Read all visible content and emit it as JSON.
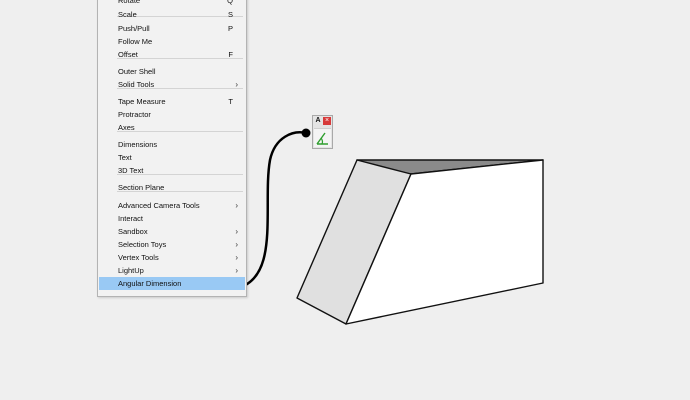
{
  "menu": {
    "items": [
      {
        "label": "Rotate",
        "shortcut": "Q"
      },
      {
        "label": "Scale",
        "shortcut": "S"
      },
      {
        "label": "Push/Pull",
        "shortcut": "P"
      },
      {
        "label": "Follow Me",
        "shortcut": ""
      },
      {
        "label": "Offset",
        "shortcut": "F"
      },
      {
        "label": "Outer Shell",
        "shortcut": ""
      },
      {
        "label": "Solid Tools",
        "arrow": "›"
      },
      {
        "label": "Tape Measure",
        "shortcut": "T"
      },
      {
        "label": "Protractor",
        "shortcut": ""
      },
      {
        "label": "Axes",
        "shortcut": ""
      },
      {
        "label": "Dimensions",
        "shortcut": ""
      },
      {
        "label": "Text",
        "shortcut": ""
      },
      {
        "label": "3D Text",
        "shortcut": ""
      },
      {
        "label": "Section Plane",
        "shortcut": ""
      },
      {
        "label": "Advanced Camera Tools",
        "arrow": "›"
      },
      {
        "label": "Interact",
        "shortcut": ""
      },
      {
        "label": "Sandbox",
        "arrow": "›"
      },
      {
        "label": "Selection Toys",
        "arrow": "›"
      },
      {
        "label": "Vertex Tools",
        "arrow": "›"
      },
      {
        "label": "LightUp",
        "arrow": "›"
      },
      {
        "label": "Angular Dimension",
        "highlighted": true
      }
    ]
  },
  "toolbar": {
    "title_letter": "A",
    "close_glyph": "×",
    "tool_icon": "angular-dimension-icon"
  },
  "colors": {
    "highlight": "#99c9f4",
    "toolbar_icon": "#2e9e2e",
    "close": "#d73a3a"
  }
}
